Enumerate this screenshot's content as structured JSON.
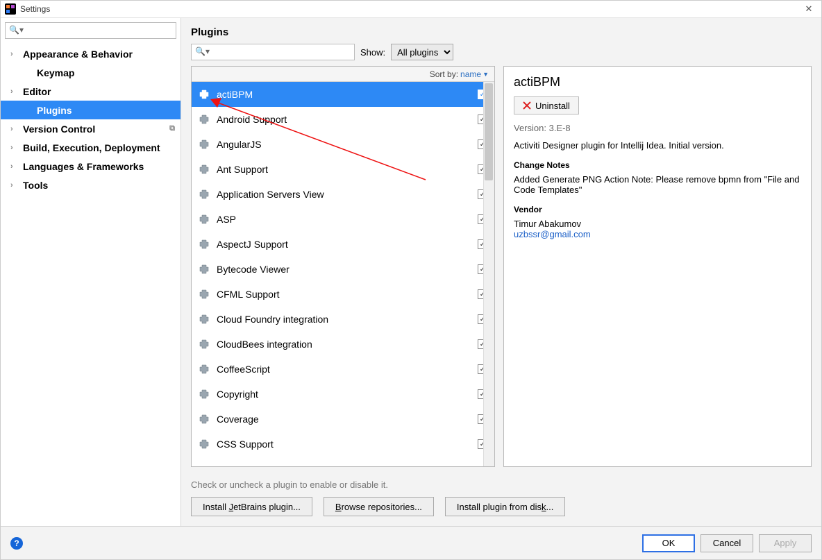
{
  "window": {
    "title": "Settings"
  },
  "sidebar": {
    "items": [
      {
        "label": "Appearance & Behavior",
        "bold": true,
        "expandable": true
      },
      {
        "label": "Keymap",
        "bold": true,
        "child": true
      },
      {
        "label": "Editor",
        "bold": true,
        "expandable": true
      },
      {
        "label": "Plugins",
        "bold": true,
        "child": true,
        "selected": true
      },
      {
        "label": "Version Control",
        "bold": true,
        "expandable": true,
        "trail": true
      },
      {
        "label": "Build, Execution, Deployment",
        "bold": true,
        "expandable": true
      },
      {
        "label": "Languages & Frameworks",
        "bold": true,
        "expandable": true
      },
      {
        "label": "Tools",
        "bold": true,
        "expandable": true
      }
    ]
  },
  "main": {
    "title": "Plugins",
    "show_label": "Show:",
    "show_value": "All plugins",
    "sort_label": "Sort by:",
    "sort_value": "name",
    "hint": "Check or uncheck a plugin to enable or disable it.",
    "buttons": {
      "install_jb": "Install JetBrains plugin...",
      "browse": "Browse repositories...",
      "from_disk": "Install plugin from disk..."
    }
  },
  "plugins": [
    {
      "name": "actiBPM",
      "checked": true,
      "selected": true
    },
    {
      "name": "Android Support",
      "checked": true
    },
    {
      "name": "AngularJS",
      "checked": true
    },
    {
      "name": "Ant Support",
      "checked": true
    },
    {
      "name": "Application Servers View",
      "checked": true
    },
    {
      "name": "ASP",
      "checked": true
    },
    {
      "name": "AspectJ Support",
      "checked": true
    },
    {
      "name": "Bytecode Viewer",
      "checked": true
    },
    {
      "name": "CFML Support",
      "checked": true
    },
    {
      "name": "Cloud Foundry integration",
      "checked": true
    },
    {
      "name": "CloudBees integration",
      "checked": true
    },
    {
      "name": "CoffeeScript",
      "checked": true
    },
    {
      "name": "Copyright",
      "checked": true
    },
    {
      "name": "Coverage",
      "checked": true
    },
    {
      "name": "CSS Support",
      "checked": true
    }
  ],
  "detail": {
    "name": "actiBPM",
    "uninstall_label": "Uninstall",
    "version_label": "Version: 3.E-8",
    "description": "Activiti Designer plugin for Intellij Idea. Initial version.",
    "change_notes_header": "Change Notes",
    "change_notes": "Added Generate PNG Action Note: Please remove bpmn from \"File and Code Templates\"",
    "vendor_header": "Vendor",
    "vendor_name": "Timur Abakumov",
    "vendor_email": "uzbssr@gmail.com"
  },
  "footer": {
    "ok": "OK",
    "cancel": "Cancel",
    "apply": "Apply"
  }
}
